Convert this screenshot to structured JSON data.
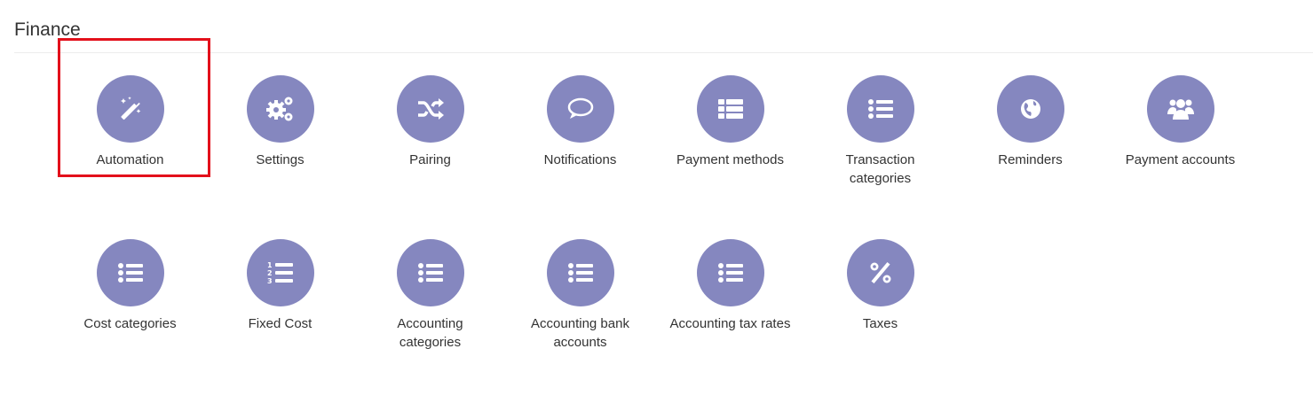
{
  "page": {
    "title": "Finance"
  },
  "colors": {
    "icon_bg": "#8587bf",
    "highlight": "#e3101b"
  },
  "tiles": [
    {
      "label": "Automation",
      "icon": "magic-wand-icon"
    },
    {
      "label": "Settings",
      "icon": "gears-icon"
    },
    {
      "label": "Pairing",
      "icon": "shuffle-icon"
    },
    {
      "label": "Notifications",
      "icon": "speech-bubble-icon"
    },
    {
      "label": "Payment methods",
      "icon": "list-icon"
    },
    {
      "label": "Transaction categories",
      "icon": "list-icon"
    },
    {
      "label": "Reminders",
      "icon": "globe-icon"
    },
    {
      "label": "Payment accounts",
      "icon": "users-icon"
    },
    {
      "label": "Cost categories",
      "icon": "list-icon"
    },
    {
      "label": "Fixed Cost",
      "icon": "ordered-list-icon"
    },
    {
      "label": "Accounting categories",
      "icon": "list-icon"
    },
    {
      "label": "Accounting bank accounts",
      "icon": "list-icon"
    },
    {
      "label": "Accounting tax rates",
      "icon": "list-icon"
    },
    {
      "label": "Taxes",
      "icon": "percent-icon"
    }
  ]
}
